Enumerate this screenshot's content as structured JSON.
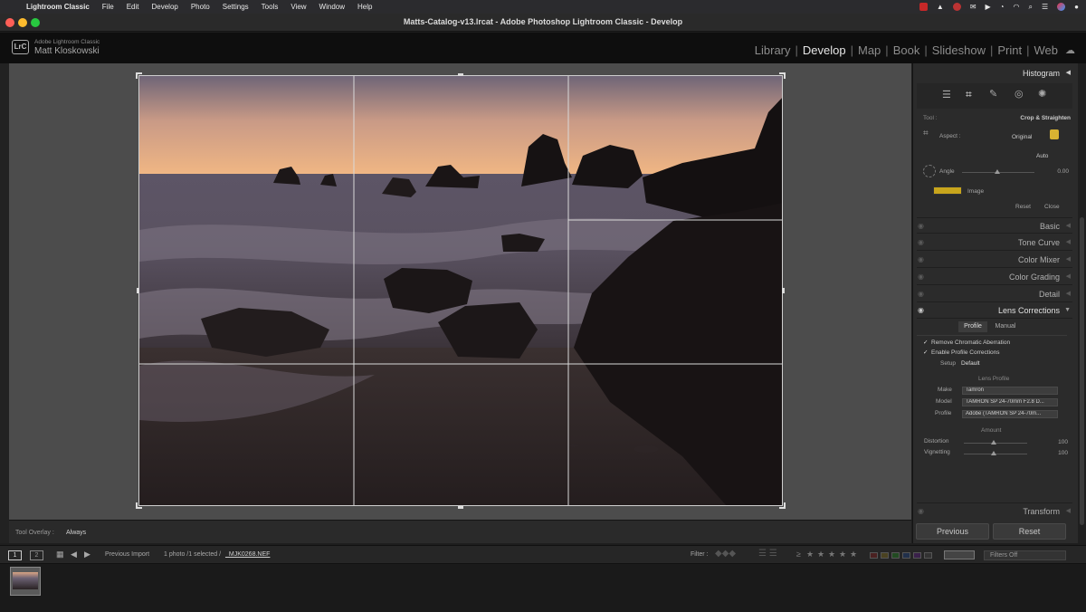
{
  "menubar": {
    "app_name": "Lightroom Classic",
    "items": [
      "File",
      "Edit",
      "Develop",
      "Photo",
      "Settings",
      "Tools",
      "View",
      "Window",
      "Help"
    ]
  },
  "window": {
    "title": "Matts-Catalog-v13.lrcat - Adobe Photoshop Lightroom Classic - Develop"
  },
  "identity": {
    "logo": "LrC",
    "product": "Adobe Lightroom Classic",
    "user": "Matt Kloskowski"
  },
  "modules": {
    "items": [
      "Library",
      "Develop",
      "Map",
      "Book",
      "Slideshow",
      "Print",
      "Web"
    ],
    "active": "Develop"
  },
  "toolbar": {
    "overlay_label": "Tool Overlay :",
    "overlay_value": "Always"
  },
  "right_panel": {
    "histogram": "Histogram",
    "crop": {
      "tool_label": "Tool :",
      "tool_name": "Crop & Straighten",
      "aspect_label": "Aspect :",
      "aspect_value": "Original",
      "auto_label": "Auto",
      "angle_label": "Angle",
      "angle_value": "0.00",
      "image_label": "Image",
      "reset_label": "Reset",
      "close_label": "Close"
    },
    "panels": [
      "Basic",
      "Tone Curve",
      "Color Mixer",
      "Color Grading",
      "Detail"
    ],
    "lens": {
      "title": "Lens Corrections",
      "tabs": [
        "Profile",
        "Manual"
      ],
      "remove_ca": "Remove Chromatic Aberration",
      "enable_profile": "Enable Profile Corrections",
      "setup_label": "Setup",
      "setup_value": "Default",
      "lens_profile": "Lens Profile",
      "make_label": "Make",
      "make_value": "Tamron",
      "model_label": "Model",
      "model_value": "TAMRON SP 24-70mm F2.8 D...",
      "profile_label": "Profile",
      "profile_value": "Adobe (TAMRON SP 24-70m...",
      "amount": "Amount",
      "distortion_label": "Distortion",
      "distortion_value": "100",
      "vignetting_label": "Vignetting",
      "vignetting_value": "100"
    },
    "transform": "Transform",
    "previous_label": "Previous",
    "reset_label": "Reset"
  },
  "filmbar": {
    "page1": "1",
    "page2": "2",
    "source": "Previous Import",
    "info": "1 photo /1 selected /",
    "filename": "_MJK0268.NEF",
    "filter_label": "Filter :",
    "filters_off": "Filters Off"
  },
  "colors": {
    "accent": "#e0e0e0",
    "panel": "#2b2b2b",
    "canvas": "#4c4c4c"
  }
}
